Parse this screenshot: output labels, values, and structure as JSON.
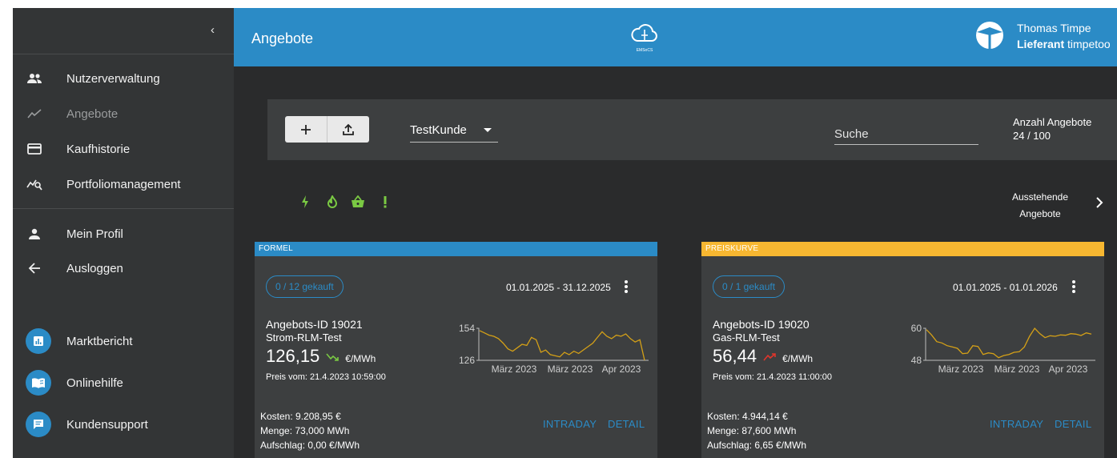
{
  "sidebar": {
    "collapse_glyph": "‹",
    "items": [
      {
        "label": "Nutzerverwaltung",
        "icon": "users-icon"
      },
      {
        "label": "Angebote",
        "icon": "trend-icon"
      },
      {
        "label": "Kaufhistorie",
        "icon": "credit-card-icon"
      },
      {
        "label": "Portfoliomanagement",
        "icon": "chart-search-icon"
      }
    ],
    "account_items": [
      {
        "label": "Mein Profil",
        "icon": "person-icon"
      },
      {
        "label": "Ausloggen",
        "icon": "arrow-left-icon"
      }
    ],
    "help_items": [
      {
        "label": "Marktbericht",
        "icon": "report-icon"
      },
      {
        "label": "Onlinehilfe",
        "icon": "book-icon"
      },
      {
        "label": "Kundensupport",
        "icon": "chat-icon"
      }
    ]
  },
  "header": {
    "title": "Angebote",
    "logo_text": "EMSoCS",
    "user_name": "Thomas Timpe",
    "user_role_bold": "Lieferant",
    "user_company": " timpetoo"
  },
  "toolbar": {
    "add_glyph": "+",
    "upload_glyph": "↥",
    "customer": "TestKunde",
    "search_placeholder": "Suche",
    "count_label": "Anzahl Angebote",
    "count_value": "24 / 100"
  },
  "filters": [
    {
      "icon": "lightning-icon"
    },
    {
      "icon": "flame-icon"
    },
    {
      "icon": "basket-icon"
    },
    {
      "icon": "exclamation-icon"
    }
  ],
  "pending": {
    "line1": "Ausstehende",
    "line2": "Angebote"
  },
  "colors": {
    "accent": "#2b8bc6",
    "preiskurve": "#f7b731",
    "filter_green": "#7ac943",
    "chart_line": "#d4a017",
    "trend_up": "#e0352b",
    "trend_down": "#7ac943"
  },
  "cards": [
    {
      "type_label": "FORMEL",
      "purchased": "0 / 12 gekauft",
      "date_range": "01.01.2025 - 31.12.2025",
      "offer_id": "Angebots-ID 19021",
      "product": "Strom-RLM-Test",
      "price": "126,15",
      "trend": "down",
      "unit": "€/MWh",
      "price_date": "Preis vom: 21.4.2023 10:59:00",
      "cost": "Kosten: 9.208,95 €",
      "quantity": "Menge: 73,000 MWh",
      "surcharge": "Aufschlag: 0,00 €/MWh",
      "intraday": "INTRADAY",
      "detail": "DETAIL",
      "chart_data": {
        "type": "line",
        "y_ticks": [
          "154",
          "126"
        ],
        "ylim": [
          126,
          154
        ],
        "x_ticks": [
          "März 2023",
          "März 2023",
          "Apr 2023"
        ],
        "values": [
          152,
          150,
          148,
          147,
          145,
          141,
          136,
          134,
          137,
          140,
          139,
          146,
          144,
          133,
          135,
          131,
          130,
          129,
          133,
          131,
          134,
          132,
          135,
          138,
          141,
          146,
          151,
          147,
          145,
          148,
          147,
          149,
          145,
          142,
          144,
          126
        ]
      }
    },
    {
      "type_label": "PREISKURVE",
      "purchased": "0 / 1 gekauft",
      "date_range": "01.01.2025 - 01.01.2026",
      "offer_id": "Angebots-ID 19020",
      "product": "Gas-RLM-Test",
      "price": "56,44",
      "trend": "up",
      "unit": "€/MWh",
      "price_date": "Preis vom: 21.4.2023 11:00:00",
      "cost": "Kosten: 4.944,14 €",
      "quantity": "Menge: 87,600 MWh",
      "surcharge": "Aufschlag: 6,65 €/MWh",
      "intraday": "INTRADAY",
      "detail": "DETAIL",
      "chart_data": {
        "type": "line",
        "y_ticks": [
          "60",
          "48"
        ],
        "ylim": [
          48,
          60
        ],
        "x_ticks": [
          "März 2023",
          "März 2023",
          "Apr 2023"
        ],
        "values": [
          59.5,
          57.5,
          55,
          54.5,
          53.5,
          53,
          52.5,
          50.5,
          50.7,
          53.5,
          53.2,
          50.2,
          50.8,
          50.5,
          49,
          49.8,
          50.2,
          51,
          51.2,
          53,
          57,
          60,
          58,
          56.5,
          57.2,
          57,
          57.5,
          57.4,
          58,
          57.8,
          57.3,
          58.3,
          57.8
        ]
      }
    }
  ]
}
